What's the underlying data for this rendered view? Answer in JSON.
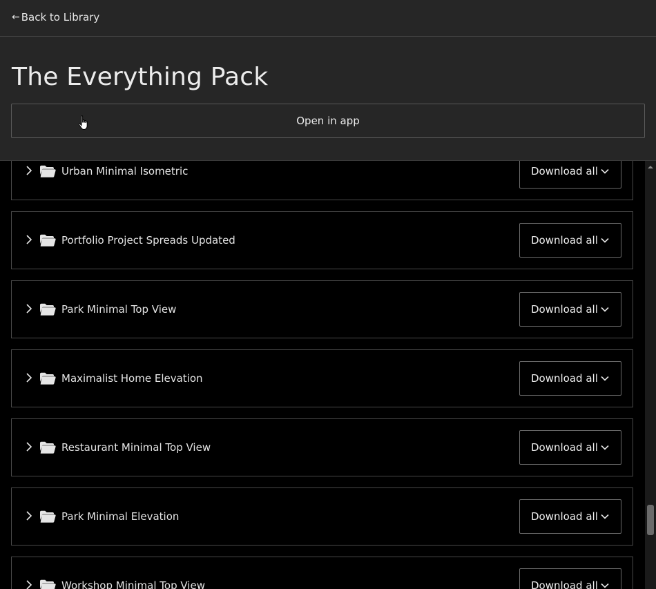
{
  "header": {
    "back_label": "Back to Library",
    "title": "The Everything Pack",
    "open_label": "Open in app"
  },
  "list": {
    "items": [
      {
        "name": "Urban Minimal Isometric",
        "action": "Download all"
      },
      {
        "name": "Portfolio Project Spreads Updated",
        "action": "Download all"
      },
      {
        "name": "Park Minimal Top View",
        "action": "Download all"
      },
      {
        "name": "Maximalist Home Elevation",
        "action": "Download all"
      },
      {
        "name": "Restaurant Minimal Top View",
        "action": "Download all"
      },
      {
        "name": "Park Minimal Elevation",
        "action": "Download all"
      },
      {
        "name": "Workshop Minimal Top View",
        "action": "Download all"
      }
    ]
  },
  "colors": {
    "header_bg": "#262626",
    "page_bg": "#000000",
    "text": "#e8e8e8",
    "border": "#4a4a4a"
  },
  "icons": {
    "back": "arrow-left-icon",
    "expand": "chevron-right-icon",
    "folder": "folder-icon",
    "dropdown": "chevron-down-icon"
  }
}
